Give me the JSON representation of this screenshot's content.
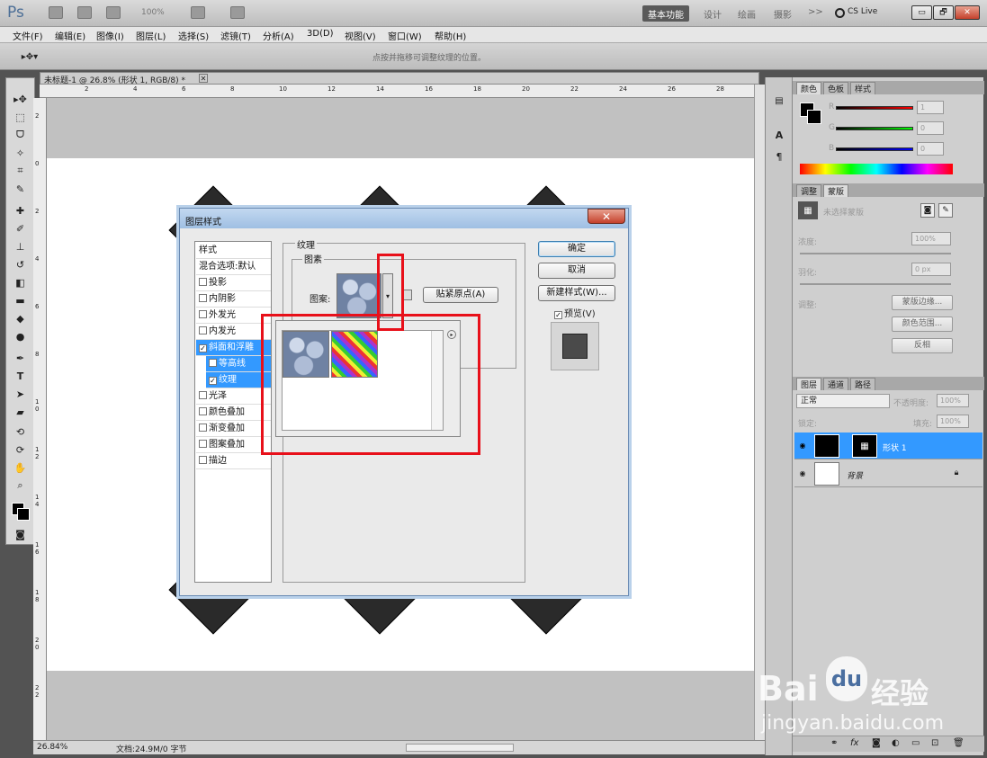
{
  "app": {
    "logo": "Ps",
    "zoom": "100%",
    "workspaces": [
      "基本功能",
      "设计",
      "绘画",
      "摄影",
      ">>"
    ],
    "cs_live": "CS Live",
    "window_buttons": [
      "▭",
      "🗗",
      "✕"
    ]
  },
  "menubar": [
    "文件(F)",
    "编辑(E)",
    "图像(I)",
    "图层(L)",
    "选择(S)",
    "滤镜(T)",
    "分析(A)",
    "3D(D)",
    "视图(V)",
    "窗口(W)",
    "帮助(H)"
  ],
  "options": {
    "hint": "点按并拖移可调整纹理的位置。"
  },
  "document": {
    "tab_title": "未标题-1 @ 26.8% (形状 1, RGB/8) *",
    "tab_close": "✕",
    "ruler_top_ticks": [
      "2",
      "4",
      "6",
      "8",
      "10",
      "12",
      "14",
      "16",
      "18",
      "20",
      "22",
      "24",
      "26",
      "28"
    ],
    "ruler_left_ticks": [
      "2",
      "0",
      "2",
      "4",
      "6",
      "8",
      "1 0",
      "1 2",
      "1 4",
      "1 6",
      "1 8",
      "2 0",
      "2 2"
    ],
    "zoom_status": "26.84%",
    "doc_status": "文档:24.9M/0 字节"
  },
  "dialog": {
    "title": "图层样式",
    "close": "✕",
    "style_list": [
      {
        "label": "样式",
        "checkbox": false,
        "checked": false,
        "selected": false,
        "sub": false
      },
      {
        "label": "混合选项:默认",
        "checkbox": false,
        "checked": false,
        "selected": false,
        "sub": false
      },
      {
        "label": "投影",
        "checkbox": true,
        "checked": false,
        "selected": false,
        "sub": false
      },
      {
        "label": "内阴影",
        "checkbox": true,
        "checked": false,
        "selected": false,
        "sub": false
      },
      {
        "label": "外发光",
        "checkbox": true,
        "checked": false,
        "selected": false,
        "sub": false
      },
      {
        "label": "内发光",
        "checkbox": true,
        "checked": false,
        "selected": false,
        "sub": false
      },
      {
        "label": "斜面和浮雕",
        "checkbox": true,
        "checked": true,
        "selected": true,
        "sub": false
      },
      {
        "label": "等高线",
        "checkbox": true,
        "checked": false,
        "selected": true,
        "sub": true
      },
      {
        "label": "纹理",
        "checkbox": true,
        "checked": true,
        "selected": true,
        "sub": true
      },
      {
        "label": "光泽",
        "checkbox": true,
        "checked": false,
        "selected": false,
        "sub": false
      },
      {
        "label": "颜色叠加",
        "checkbox": true,
        "checked": false,
        "selected": false,
        "sub": false
      },
      {
        "label": "渐变叠加",
        "checkbox": true,
        "checked": false,
        "selected": false,
        "sub": false
      },
      {
        "label": "图案叠加",
        "checkbox": true,
        "checked": false,
        "selected": false,
        "sub": false
      },
      {
        "label": "描边",
        "checkbox": true,
        "checked": false,
        "selected": false,
        "sub": false
      }
    ],
    "section_texture": "纹理",
    "section_pattern": "图素",
    "pattern_label": "图案:",
    "snap_button": "贴紧原点(A)",
    "ok": "确定",
    "cancel": "取消",
    "new_style": "新建样式(W)...",
    "preview_label": "预览(V)",
    "preview_checked": "✓"
  },
  "panels": {
    "color_tabs": [
      "颜色",
      "色板",
      "样式"
    ],
    "rgb": [
      {
        "label": "R",
        "value": "1"
      },
      {
        "label": "G",
        "value": "0"
      },
      {
        "label": "B",
        "value": "0"
      }
    ],
    "adjust_tabs": [
      "调整",
      "蒙版"
    ],
    "mask_label": "未选择蒙版",
    "density_label": "浓度:",
    "density_value": "100%",
    "feather_label": "羽化:",
    "feather_value": "0 px",
    "refine_label": "调整:",
    "mask_edge": "蒙版边缘...",
    "color_range": "颜色范围...",
    "invert": "反相",
    "layer_tabs": [
      "图层",
      "通道",
      "路径"
    ],
    "blend_mode": "正常",
    "opacity_label": "不透明度:",
    "opacity_value": "100%",
    "lock_label": "锁定:",
    "fill_label": "填充:",
    "fill_value": "100%",
    "layers": [
      {
        "name": "形状 1",
        "selected": true
      },
      {
        "name": "背景",
        "selected": false
      }
    ]
  },
  "watermark": {
    "brand": "Bai",
    "brand2": "经验",
    "url": "jingyan.baidu.com"
  }
}
